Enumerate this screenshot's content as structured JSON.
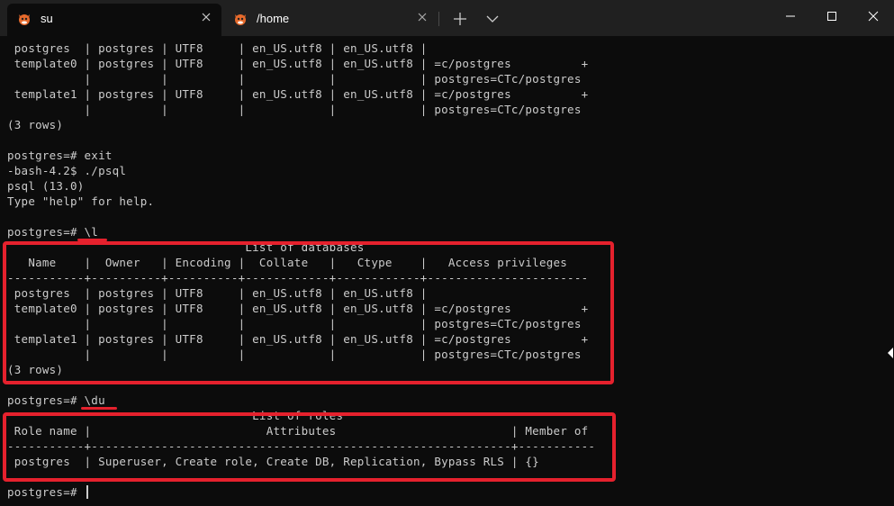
{
  "window": {
    "tabs": [
      {
        "label": "su",
        "active": true,
        "icon": "penguin-icon"
      },
      {
        "label": "/home",
        "active": false,
        "icon": "penguin-icon"
      }
    ],
    "controls": [
      "minimize-icon",
      "maximize-icon",
      "close-icon"
    ]
  },
  "colors": {
    "background": "#0c0c0c",
    "text": "#cccccc",
    "highlight": "#e5212d",
    "titlebar": "#202020"
  },
  "terminal": {
    "lines": [
      " postgres  | postgres | UTF8     | en_US.utf8 | en_US.utf8 |",
      " template0 | postgres | UTF8     | en_US.utf8 | en_US.utf8 | =c/postgres          +",
      "           |          |          |            |            | postgres=CTc/postgres",
      " template1 | postgres | UTF8     | en_US.utf8 | en_US.utf8 | =c/postgres          +",
      "           |          |          |            |            | postgres=CTc/postgres",
      "(3 rows)",
      "",
      "postgres=# exit",
      "-bash-4.2$ ./psql",
      "psql (13.0)",
      "Type \"help\" for help.",
      "",
      "postgres=# \\l",
      "                                  List of databases",
      "   Name    |  Owner   | Encoding |  Collate   |   Ctype    |   Access privileges",
      "-----------+----------+----------+------------+------------+-----------------------",
      " postgres  | postgres | UTF8     | en_US.utf8 | en_US.utf8 |",
      " template0 | postgres | UTF8     | en_US.utf8 | en_US.utf8 | =c/postgres          +",
      "           |          |          |            |            | postgres=CTc/postgres",
      " template1 | postgres | UTF8     | en_US.utf8 | en_US.utf8 | =c/postgres          +",
      "           |          |          |            |            | postgres=CTc/postgres",
      "(3 rows)",
      "",
      "postgres=# \\du",
      "                                   List of roles",
      " Role name |                         Attributes                         | Member of",
      "-----------+------------------------------------------------------------+-----------",
      " postgres  | Superuser, Create role, Create DB, Replication, Bypass RLS | {}",
      "",
      "postgres=# "
    ]
  }
}
